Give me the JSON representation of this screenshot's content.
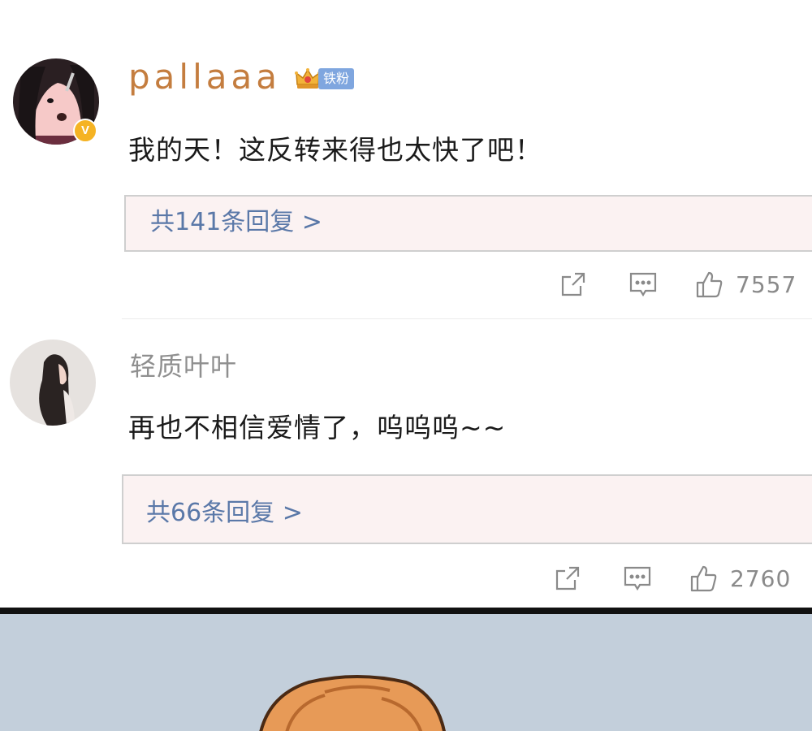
{
  "comments": [
    {
      "username": "pallaaa",
      "fan_tag": "铁粉",
      "verified_mark": "V",
      "text": "我的天！这反转来得也太快了吧！",
      "replies_link": "共141条回复 >",
      "likes": "7557"
    },
    {
      "username": "轻质叶叶",
      "text": "再也不相信爱情了，呜呜呜~~",
      "replies_link": "共66条回复 >",
      "likes": "2760"
    }
  ],
  "icons": {
    "share": "share-icon",
    "comment": "comment-icon",
    "like": "thumbs-up-icon",
    "crown": "crown-icon"
  },
  "colors": {
    "username_highlight": "#c47d3f",
    "username_normal": "#8f8f8f",
    "reply_link": "#5a78a8",
    "reply_box_bg": "#fbf2f2",
    "fan_tag": "#7fa6df",
    "verified_badge": "#f5b323",
    "manga_bg": "#c3cfdb"
  }
}
